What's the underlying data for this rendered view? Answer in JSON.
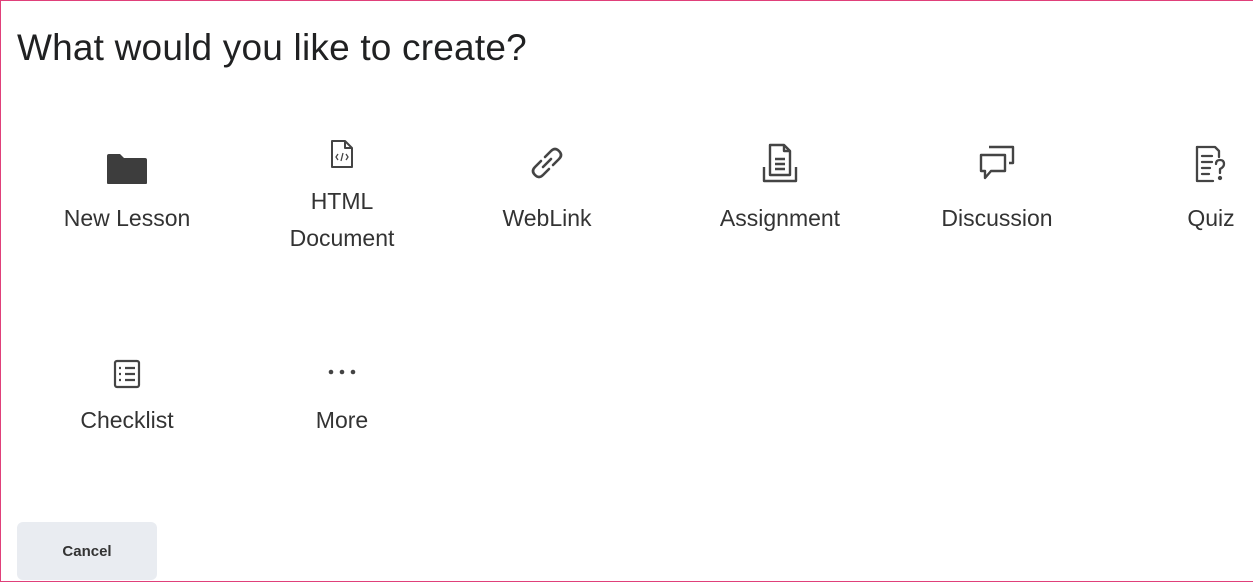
{
  "dialog": {
    "title": "What would you like to create?",
    "accent_color": "#e0407a",
    "options": [
      {
        "label": "New Lesson",
        "icon": "folder-icon"
      },
      {
        "label_line1": "HTML",
        "label_line2": "Document",
        "icon": "html-document-icon"
      },
      {
        "label": "WebLink",
        "icon": "link-icon"
      },
      {
        "label": "Assignment",
        "icon": "assignment-icon"
      },
      {
        "label": "Discussion",
        "icon": "discussion-icon"
      },
      {
        "label": "Quiz",
        "icon": "quiz-icon"
      },
      {
        "label": "Checklist",
        "icon": "checklist-icon"
      },
      {
        "label": "More",
        "icon": "more-icon"
      }
    ],
    "cancel_label": "Cancel"
  }
}
